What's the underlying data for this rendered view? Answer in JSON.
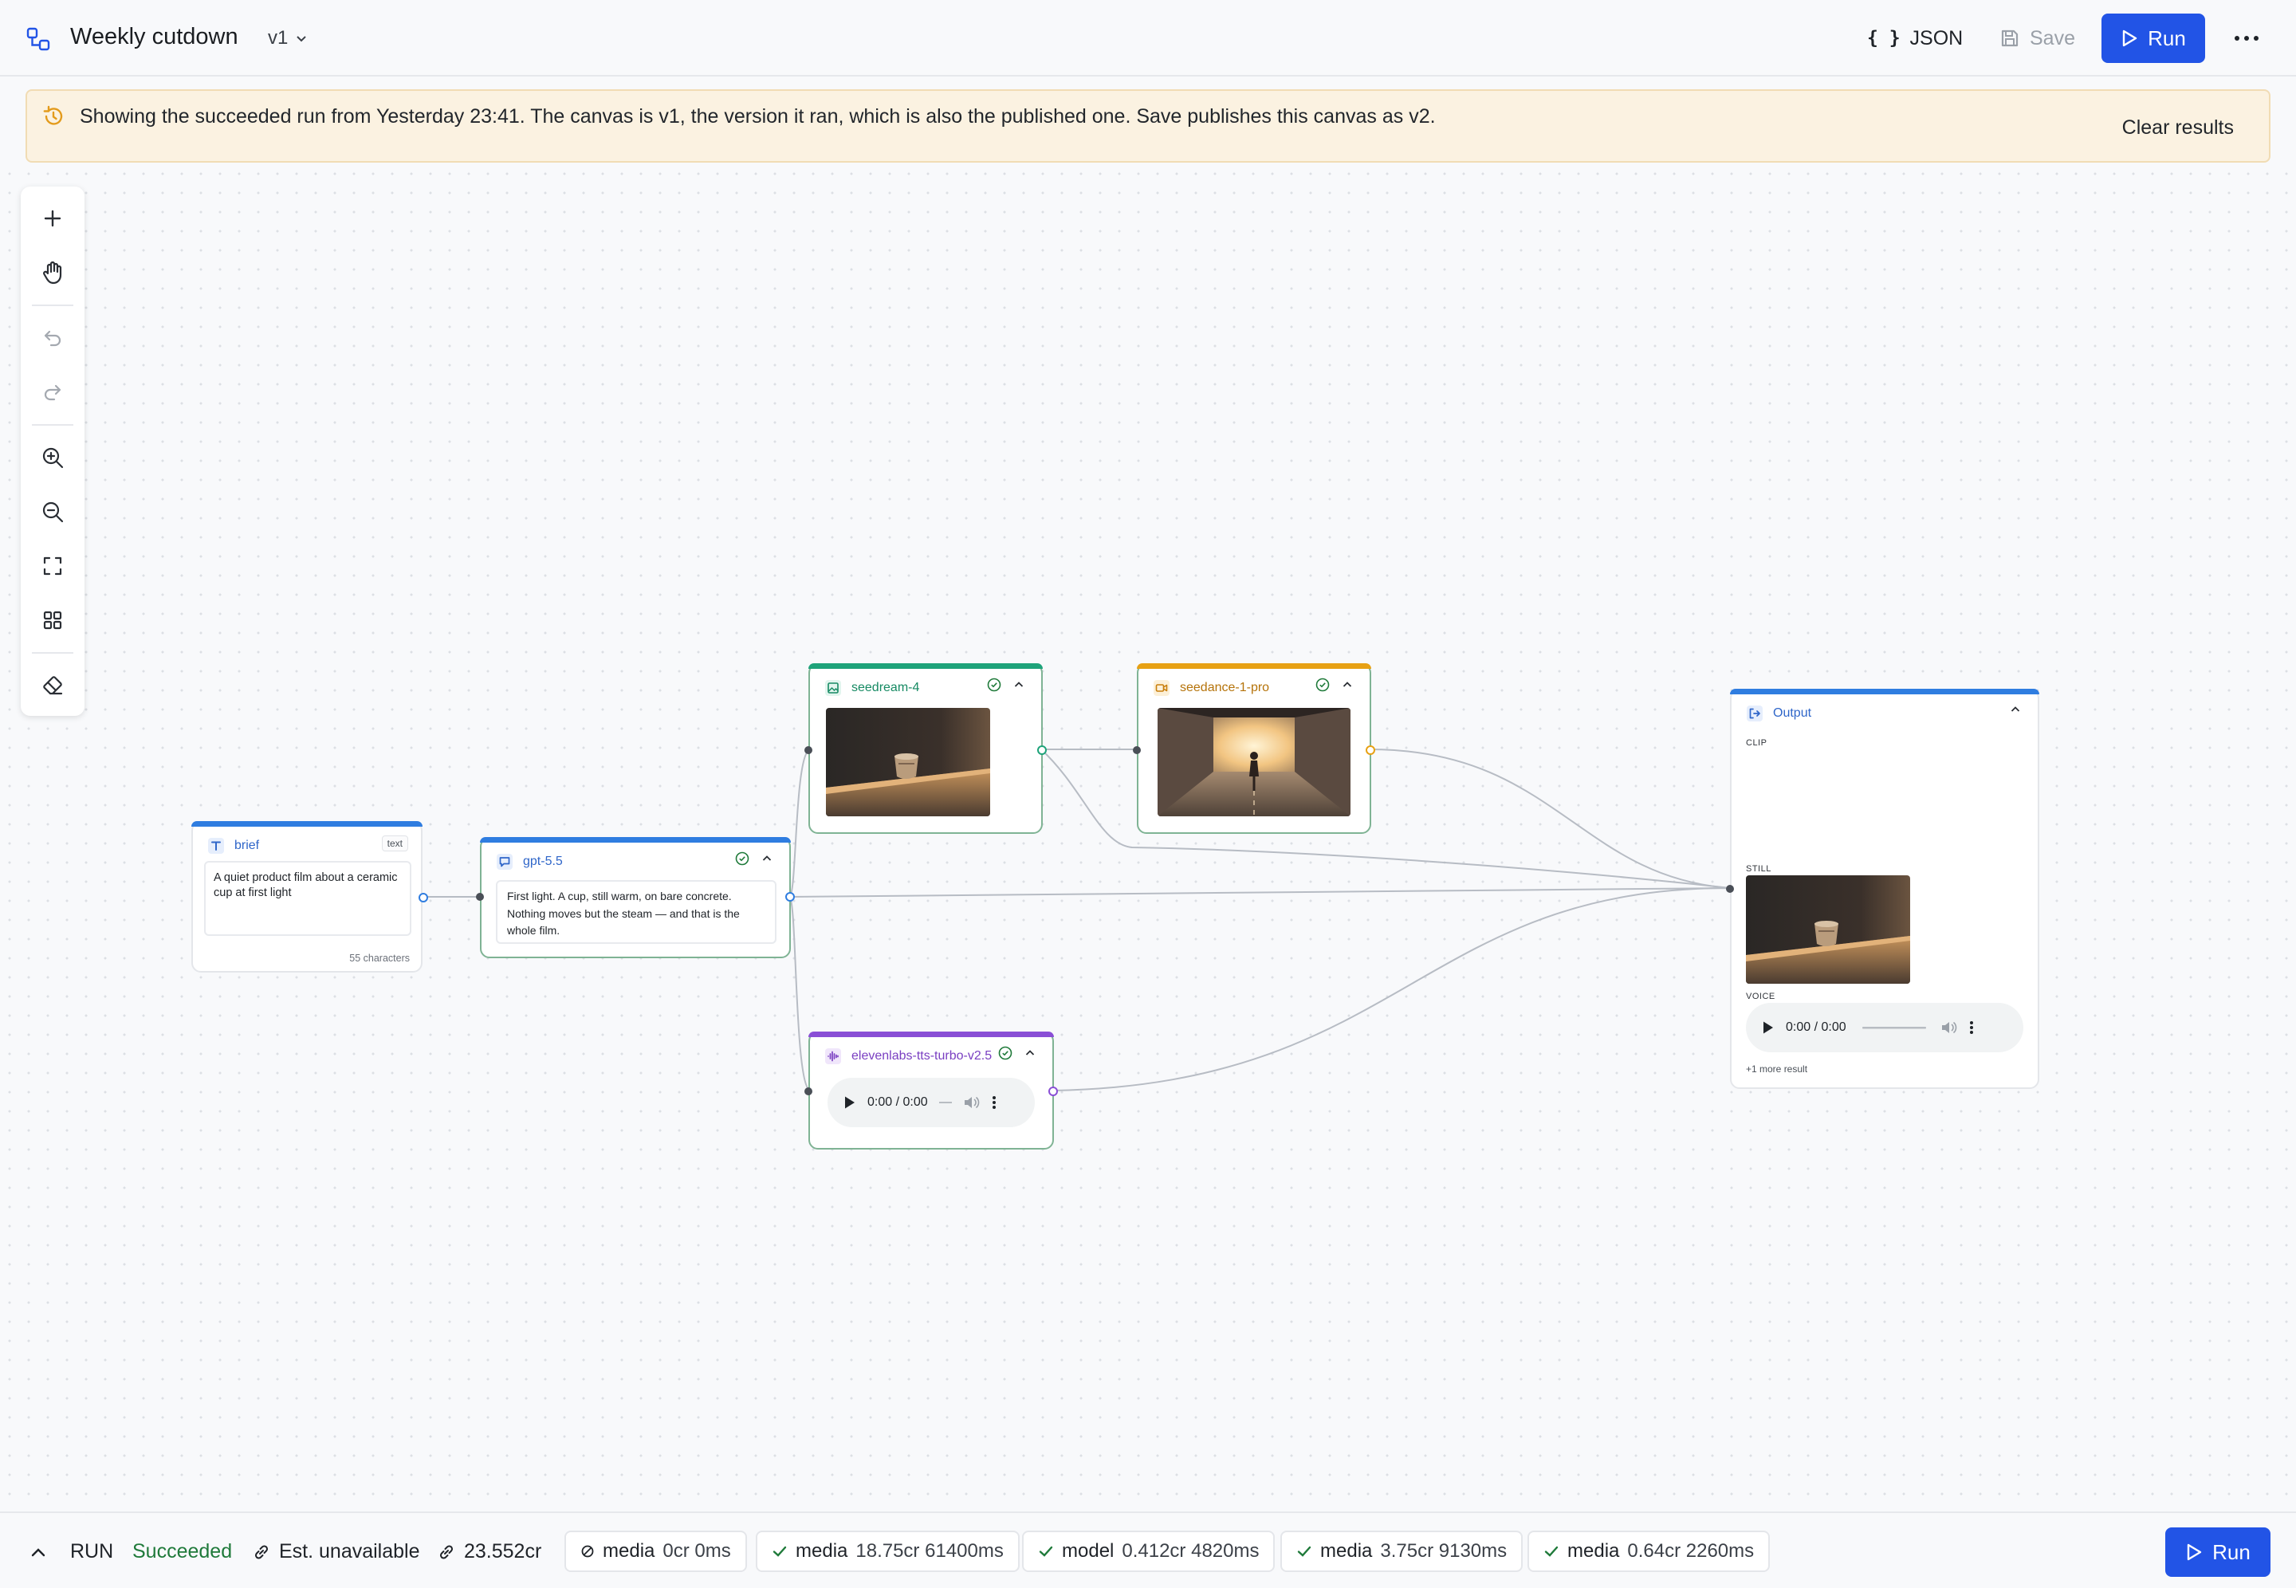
{
  "header": {
    "title": "Weekly cutdown",
    "version": "v1",
    "json_label": "JSON",
    "json_icon": "braces-icon",
    "save_label": "Save",
    "run_label": "Run"
  },
  "banner": {
    "message": "Showing the succeeded run from Yesterday 23:41. The canvas is v1, the version it ran, which is also the published one. Save publishes this canvas as v2.",
    "clear_label": "Clear results"
  },
  "nodes": {
    "brief": {
      "title": "brief",
      "tag": "text",
      "value": "A quiet product film about a ceramic cup at first light",
      "count": "55 characters",
      "color": "#2f7de0"
    },
    "gpt": {
      "title": "gpt-5.5",
      "output": "First light. A cup, still warm, on bare concrete. Nothing moves but the steam — and that is the whole film.",
      "color": "#2f7de0"
    },
    "seedream": {
      "title": "seedream-4",
      "color": "#1ea37a"
    },
    "seedance": {
      "title": "seedance-1-pro",
      "color": "#e7a114"
    },
    "tts": {
      "title": "elevenlabs-tts-turbo-v2.5",
      "time": "0:00 / 0:00",
      "color": "#8a4fd6"
    },
    "output": {
      "title": "Output",
      "clip_label": "CLIP",
      "still_label": "STILL",
      "voice_label": "VOICE",
      "time": "0:00 / 0:00",
      "more": "+1 more result",
      "color": "#2f7de0"
    }
  },
  "bottom": {
    "run_label": "RUN",
    "status": "Succeeded",
    "estimate": "Est. unavailable",
    "credits": "23.552cr",
    "chips": [
      {
        "icon": "ban-icon",
        "kind": "media",
        "detail": "0cr 0ms"
      },
      {
        "icon": "check-icon",
        "kind": "media",
        "detail": "18.75cr 61400ms"
      },
      {
        "icon": "check-icon",
        "kind": "model",
        "detail": "0.412cr 4820ms"
      },
      {
        "icon": "check-icon",
        "kind": "media",
        "detail": "3.75cr 9130ms"
      },
      {
        "icon": "check-icon",
        "kind": "media",
        "detail": "0.64cr 2260ms"
      }
    ],
    "run_button": "Run"
  },
  "colors": {
    "accent": "#2254e6",
    "success": "#1f7a3a",
    "node_ok_border": "#7fb394",
    "banner_bg": "#fbf2e1"
  }
}
